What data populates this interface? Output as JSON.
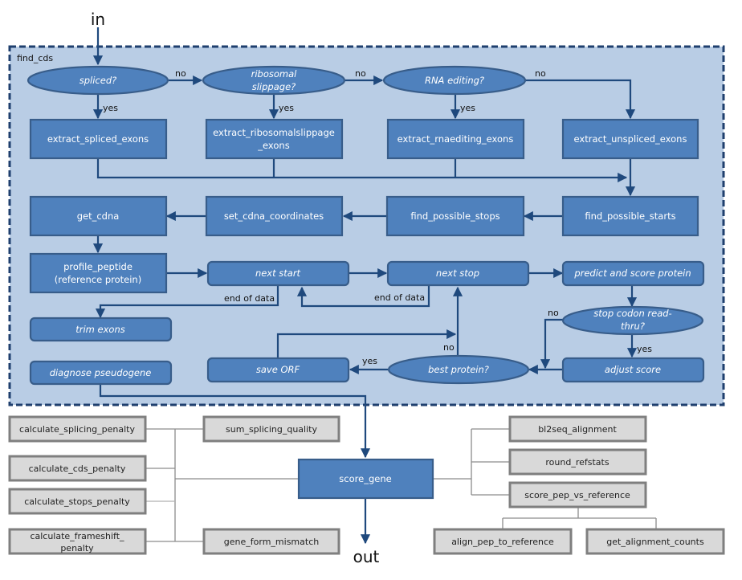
{
  "io": {
    "in": "in",
    "out": "out"
  },
  "frame": {
    "label": "find_cds"
  },
  "decisions": {
    "spliced": "spliced?",
    "ribosomal_1": "ribosomal",
    "ribosomal_2": "slippage?",
    "rna_editing": "RNA editing?",
    "readthru_1": "stop codon read-",
    "readthru_2": "thru?",
    "best_protein": "best protein?"
  },
  "processes": {
    "extract_spliced": "extract_spliced_exons",
    "extract_ribo_1": "extract_ribosomalslippage",
    "extract_ribo_2": "_exons",
    "extract_rnaediting": "extract_rnaediting_exons",
    "extract_unspliced": "extract_unspliced_exons",
    "get_cdna": "get_cdna",
    "set_cdna": "set_cdna_coordinates",
    "find_stops": "find_possible_stops",
    "find_starts": "find_possible_starts",
    "profile_1": "profile_peptide",
    "profile_2": "(reference protein)",
    "score_gene": "score_gene"
  },
  "steps": {
    "next_start": "next  start",
    "next_stop": "next  stop",
    "predict": "predict and score protein",
    "trim": "trim exons",
    "diagnose": "diagnose pseudogene",
    "save_orf": "save ORF",
    "adjust": "adjust score"
  },
  "edge_labels": {
    "no": "no",
    "yes": "yes",
    "end_of_data": "end of data"
  },
  "helpers_left": {
    "splicing_penalty": "calculate_splicing_penalty",
    "cds_penalty": "calculate_cds_penalty",
    "stops_penalty": "calculate_stops_penalty",
    "frameshift_1": "calculate_frameshift_",
    "frameshift_2": "penalty",
    "sum_splicing": "sum_splicing_quality",
    "gene_form": "gene_form_mismatch"
  },
  "helpers_right": {
    "bl2seq": "bl2seq_alignment",
    "round_refstats": "round_refstats",
    "score_pep": "score_pep_vs_reference",
    "align_pep": "align_pep_to_reference",
    "alignment_counts": "get_alignment_counts"
  },
  "colors": {
    "frame_fill": "#b9cde5",
    "frame_border": "#1f3f6e",
    "node_fill": "#4f81bd",
    "node_border": "#385d8a",
    "arrow": "#1f497d",
    "helper_fill": "#d9d9d9",
    "helper_border": "#7f7f7f"
  }
}
